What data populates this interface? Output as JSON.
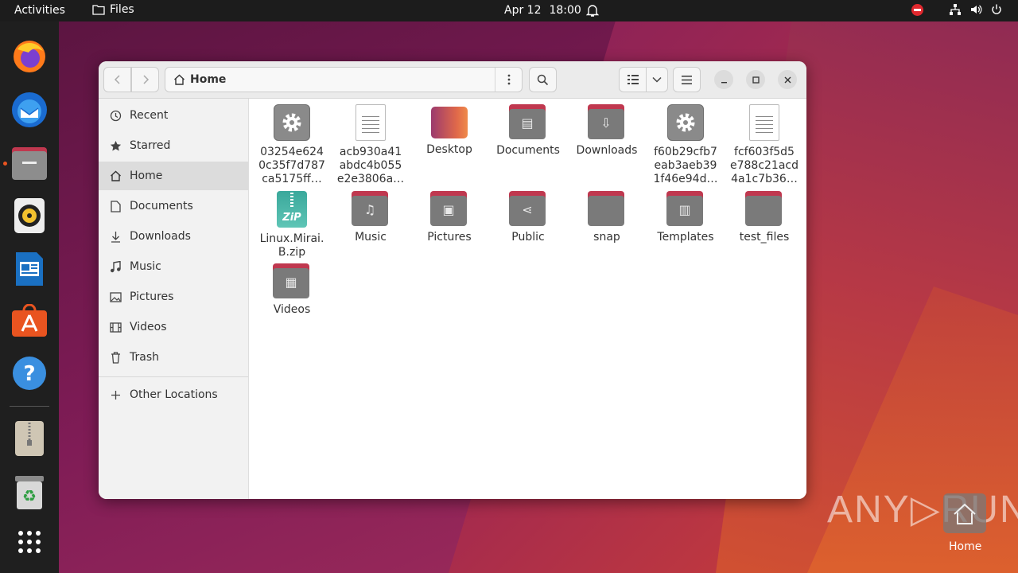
{
  "topbar": {
    "activities": "Activities",
    "app_name": "Files",
    "date": "Apr 12",
    "time": "18:00"
  },
  "dock": {
    "items": [
      {
        "name": "Firefox",
        "icon": "firefox-icon"
      },
      {
        "name": "Thunderbird",
        "icon": "thunderbird-icon"
      },
      {
        "name": "Files",
        "icon": "files-icon"
      },
      {
        "name": "Rhythmbox",
        "icon": "rhythmbox-icon"
      },
      {
        "name": "LibreOffice Writer",
        "icon": "writer-icon"
      },
      {
        "name": "Ubuntu Software",
        "icon": "software-icon"
      },
      {
        "name": "Help",
        "icon": "help-icon"
      },
      {
        "name": "Archive",
        "icon": "archive-icon"
      },
      {
        "name": "Trash",
        "icon": "trash-icon"
      },
      {
        "name": "Show Applications",
        "icon": "app-grid-icon"
      }
    ]
  },
  "window": {
    "path": "Home"
  },
  "sidebar": {
    "items": [
      {
        "label": "Recent",
        "icon": "clock-icon"
      },
      {
        "label": "Starred",
        "icon": "star-icon"
      },
      {
        "label": "Home",
        "icon": "home-icon",
        "active": true
      },
      {
        "label": "Documents",
        "icon": "document-icon"
      },
      {
        "label": "Downloads",
        "icon": "download-icon"
      },
      {
        "label": "Music",
        "icon": "music-icon"
      },
      {
        "label": "Pictures",
        "icon": "picture-icon"
      },
      {
        "label": "Videos",
        "icon": "video-icon"
      },
      {
        "label": "Trash",
        "icon": "trash-icon"
      }
    ],
    "other_locations": "Other Locations"
  },
  "files": [
    {
      "l1": "03254e624",
      "l2": "0c35f7d787",
      "l3": "ca5175ff…",
      "type": "executable"
    },
    {
      "l1": "acb930a41",
      "l2": "abdc4b055",
      "l3": "e2e3806a…",
      "type": "text"
    },
    {
      "l1": "Desktop",
      "type": "desktop"
    },
    {
      "l1": "Documents",
      "type": "folder",
      "symbol": "▤"
    },
    {
      "l1": "Downloads",
      "type": "folder",
      "symbol": "⇩"
    },
    {
      "l1": "f60b29cfb7",
      "l2": "eab3aeb39",
      "l3": "1f46e94d…",
      "type": "executable"
    },
    {
      "l1": "fcf603f5d5",
      "l2": "e788c21acd",
      "l3": "4a1c7b36…",
      "type": "text"
    },
    {
      "l1": "Linux.Mirai.",
      "l2": "B.zip",
      "type": "zip"
    },
    {
      "l1": "Music",
      "type": "folder",
      "symbol": "♫"
    },
    {
      "l1": "Pictures",
      "type": "folder",
      "symbol": "▣"
    },
    {
      "l1": "Public",
      "type": "folder",
      "symbol": "⋖"
    },
    {
      "l1": "snap",
      "type": "folder",
      "symbol": ""
    },
    {
      "l1": "Templates",
      "type": "folder",
      "symbol": "▥"
    },
    {
      "l1": "test_files",
      "type": "folder",
      "symbol": ""
    },
    {
      "l1": "Videos",
      "type": "folder",
      "symbol": "▦"
    }
  ],
  "zip_text": "ZiP",
  "desktop_home": "Home",
  "watermark": "ANY▷RUN"
}
